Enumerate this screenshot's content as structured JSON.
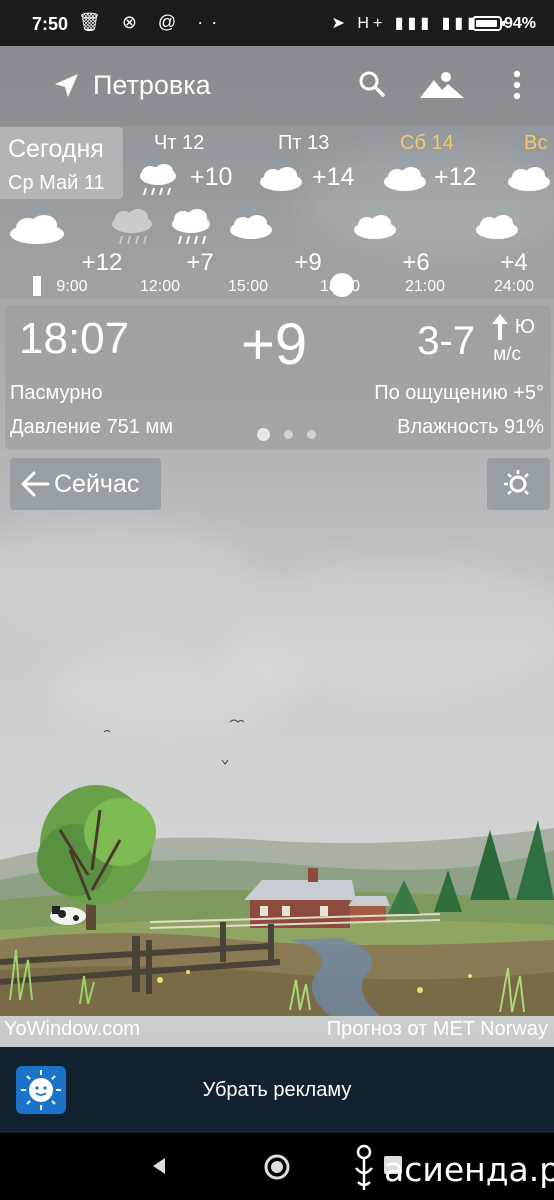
{
  "status_bar": {
    "time": "7:50",
    "left_icons": "🗑 ⊗ @ ··",
    "right_icons": "➤ H+ ▮▮▮ ▮▮▮",
    "battery_percent": "94%"
  },
  "header": {
    "location": "Петровка"
  },
  "days": {
    "today_label": "Сегодня",
    "today_date": "Ср Май 11",
    "items": [
      {
        "name": "Чт 12",
        "temp": "+10",
        "icon": "rain-cloud-icon"
      },
      {
        "name": "Пт 13",
        "temp": "+14",
        "icon": "cloud-icon"
      },
      {
        "name": "Сб 14",
        "temp": "+12",
        "icon": "cloud-icon",
        "weekend": true
      },
      {
        "name": "Вс",
        "temp": "",
        "icon": "cloud-icon",
        "weekend": true
      }
    ],
    "weekend_color": "#f5c76a"
  },
  "hourly": {
    "items": [
      {
        "time": "9:00",
        "temp": "+12"
      },
      {
        "time": "12:00",
        "temp": "+7"
      },
      {
        "time": "15:00",
        "temp": ""
      },
      {
        "time": "18:00",
        "temp": "+9"
      },
      {
        "time": "21:00",
        "temp": "+6"
      },
      {
        "time": "24:00",
        "temp": "+4"
      }
    ]
  },
  "current": {
    "time": "18:07",
    "temp": "+9",
    "wind_speed": "3-7",
    "wind_dir": "Ю",
    "wind_unit": "м/с",
    "condition": "Пасмурно",
    "feels_like": "По ощущению +5°",
    "pressure": "Давление 751 мм",
    "humidity": "Влажность 91%"
  },
  "now_button": {
    "label": "Сейчас"
  },
  "credits": {
    "left": "YoWindow.com",
    "right": "Прогноз от MET Norway"
  },
  "ad": {
    "label": "Убрать рекламу"
  },
  "watermark": {
    "text": "асиенда.ру"
  }
}
